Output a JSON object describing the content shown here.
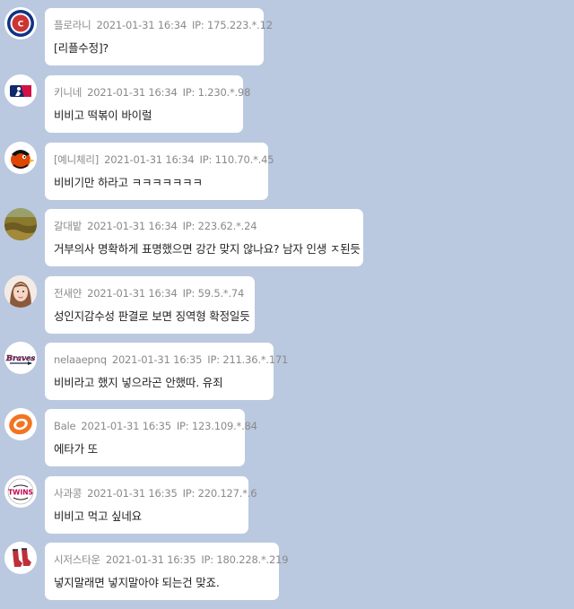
{
  "messages": [
    {
      "avatar": "cubs-logo",
      "name": "플로라니",
      "time": "2021-01-31 16:34",
      "ip": "IP: 175.223.*.12",
      "text": "[리플수정]?"
    },
    {
      "avatar": "mlb-logo",
      "name": "키니네",
      "time": "2021-01-31 16:34",
      "ip": "IP: 1.230.*.98",
      "text": "비비고 떡볶이 바이럴"
    },
    {
      "avatar": "orioles-logo",
      "name": "[예니체리]",
      "time": "2021-01-31 16:34",
      "ip": "IP: 110.70.*.45",
      "text": "비비기만 하라고 ㅋㅋㅋㅋㅋㅋㅋ"
    },
    {
      "avatar": "field-photo",
      "name": "갈대밭",
      "time": "2021-01-31 16:34",
      "ip": "IP: 223.62.*.24",
      "text": "거부의사 명확하게 표명했으면 강간 맞지 않나요? 남자 인생 ㅈ된듯"
    },
    {
      "avatar": "person-photo",
      "name": "전새얀",
      "time": "2021-01-31 16:34",
      "ip": "IP: 59.5.*.74",
      "text": "성인지감수성 판결로 보면 징역형 확정일듯"
    },
    {
      "avatar": "braves-logo",
      "name": "nelaaepnq",
      "time": "2021-01-31 16:35",
      "ip": "IP: 211.36.*.171",
      "text": "비비라고 했지 넣으라곤 안했따. 유죄"
    },
    {
      "avatar": "eagles-logo",
      "name": "Bale",
      "time": "2021-01-31 16:35",
      "ip": "IP: 123.109.*.84",
      "text": "에타가 또"
    },
    {
      "avatar": "twins-logo",
      "name": "사과콩",
      "time": "2021-01-31 16:35",
      "ip": "IP: 220.127.*.6",
      "text": "비비고 먹고 싶네요"
    },
    {
      "avatar": "redsox-logo",
      "name": "시저스타운",
      "time": "2021-01-31 16:35",
      "ip": "IP: 180.228.*.219",
      "text": "넣지말래면 넣지말아야 되는건 맞죠."
    }
  ]
}
